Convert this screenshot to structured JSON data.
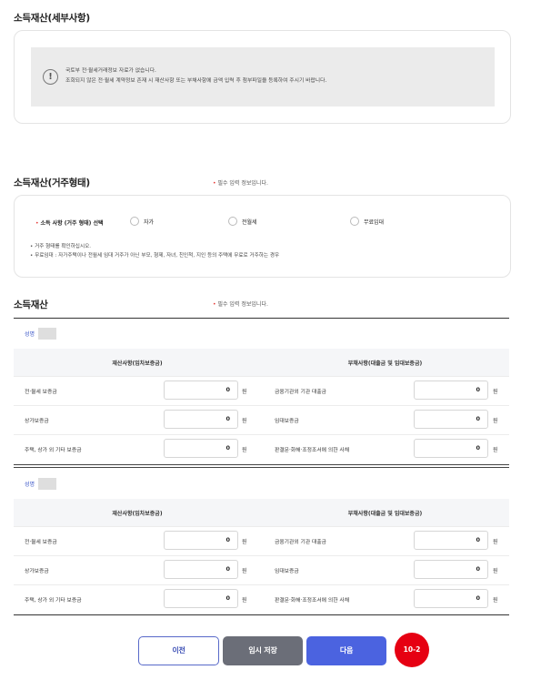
{
  "section_detail": {
    "title": "소득재산(세부사항)",
    "notice_icon": "exclamation-circle-icon",
    "notice_line1": "국토부 전·월세거래정보 자료가 없습니다.",
    "notice_line2": "조회되지 않은 전·월세 계약정보 존재 시 재산사항 또는 부채사항에 금액 입력 후 첨부파일을 등록하여 주시기 바랍니다."
  },
  "section_housing": {
    "title": "소득재산(거주형태)",
    "required_note": "필수 입력 정보입니다.",
    "required_mark": "•",
    "field_label": "소득 사항 (거주 형태) 선택",
    "options": [
      "자가",
      "전월세",
      "무료임대"
    ],
    "hint1": "• 거주 형태를 확인하십시오.",
    "hint2": "• 무료임대 : 자가주택이나 전월세 임대 거주가 아닌 부모, 형제, 자녀, 친인척, 지인 등의 주택에 무료로 거주하는 경우"
  },
  "section_assets": {
    "title": "소득재산",
    "required_note": "필수 입력 정보입니다.",
    "persons": [
      {
        "name_label": "성명",
        "asset_header": "재산사항(임차보증금)",
        "debt_header": "부채사항(대출금 및 임대보증금)",
        "rows": [
          {
            "asset_label": "전·월세 보증금",
            "asset_value": "0",
            "debt_label": "금융기관외 기관 대출금",
            "debt_value": "0"
          },
          {
            "asset_label": "상가보증금",
            "asset_value": "0",
            "debt_label": "임대보증금",
            "debt_value": "0"
          },
          {
            "asset_label": "주택, 상가 외 기타 보증금",
            "asset_value": "0",
            "debt_label": "판결문·화해·조정조서에 의한 사채",
            "debt_value": "0"
          }
        ]
      },
      {
        "name_label": "성명",
        "asset_header": "재산사항(임차보증금)",
        "debt_header": "부채사항(대출금 및 임대보증금)",
        "rows": [
          {
            "asset_label": "전·월세 보증금",
            "asset_value": "0",
            "debt_label": "금융기관외 기관 대출금",
            "debt_value": "0"
          },
          {
            "asset_label": "상가보증금",
            "asset_value": "0",
            "debt_label": "임대보증금",
            "debt_value": "0"
          },
          {
            "asset_label": "주택, 상가 외 기타 보증금",
            "asset_value": "0",
            "debt_label": "판결문·화해·조정조서에 의한 사채",
            "debt_value": "0"
          }
        ]
      }
    ],
    "unit": "원"
  },
  "buttons": {
    "prev": "이전",
    "temp_save": "임시 저장",
    "next": "다음"
  },
  "step_badge": "10-2",
  "colors": {
    "accent_blue": "#4b63e0",
    "required_red": "#e53935",
    "badge_red": "#e60012",
    "temp_gray": "#6b6e78"
  }
}
